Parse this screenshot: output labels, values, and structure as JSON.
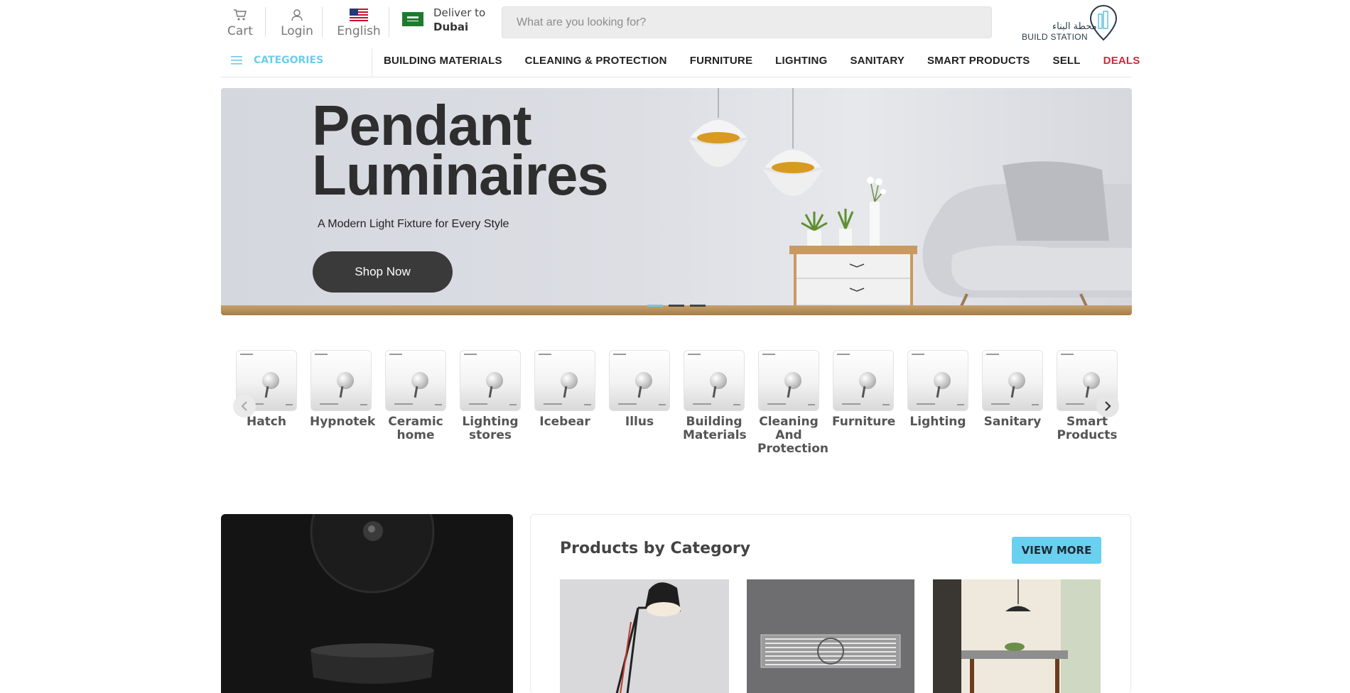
{
  "header": {
    "cart_label": "Cart",
    "login_label": "Login",
    "language_label": "English",
    "deliver_to_label": "Deliver to",
    "deliver_city": "Dubai",
    "search_placeholder": "What are you looking for?",
    "logo_arabic": "محطة البناء",
    "logo_english": "BUILD STATION"
  },
  "nav": {
    "categories_label": "CATEGORIES",
    "items": [
      "BUILDING MATERIALS",
      "CLEANING & PROTECTION",
      "FURNITURE",
      "LIGHTING",
      "SANITARY",
      "SMART PRODUCTS",
      "SELL",
      "DEALS"
    ]
  },
  "hero": {
    "title_line1": "Pendant",
    "title_line2": "Luminaires",
    "subtitle": "A Modern Light Fixture for Every Style",
    "cta_label": "Shop Now",
    "active_slide": 1,
    "slide_count": 3
  },
  "brands": [
    {
      "line1": "Hatch",
      "line2": "",
      "line3": ""
    },
    {
      "line1": "Hypnotek",
      "line2": "",
      "line3": ""
    },
    {
      "line1": "Ceramic",
      "line2": "home",
      "line3": ""
    },
    {
      "line1": "Lighting",
      "line2": "stores",
      "line3": ""
    },
    {
      "line1": "Icebear",
      "line2": "",
      "line3": ""
    },
    {
      "line1": "Illus",
      "line2": "",
      "line3": ""
    },
    {
      "line1": "Building",
      "line2": "Materials",
      "line3": ""
    },
    {
      "line1": "Cleaning",
      "line2": "And",
      "line3": "Protection"
    },
    {
      "line1": "Furniture",
      "line2": "",
      "line3": ""
    },
    {
      "line1": "Lighting",
      "line2": "",
      "line3": ""
    },
    {
      "line1": "Sanitary",
      "line2": "",
      "line3": ""
    },
    {
      "line1": "Smart",
      "line2": "Products",
      "line3": ""
    }
  ],
  "category_section": {
    "title": "Products by Category",
    "view_more_label": "VIEW MORE"
  },
  "colors": {
    "accent": "#6ad0ef",
    "deals": "#d0283b",
    "dark_button": "#3a3a3a"
  }
}
